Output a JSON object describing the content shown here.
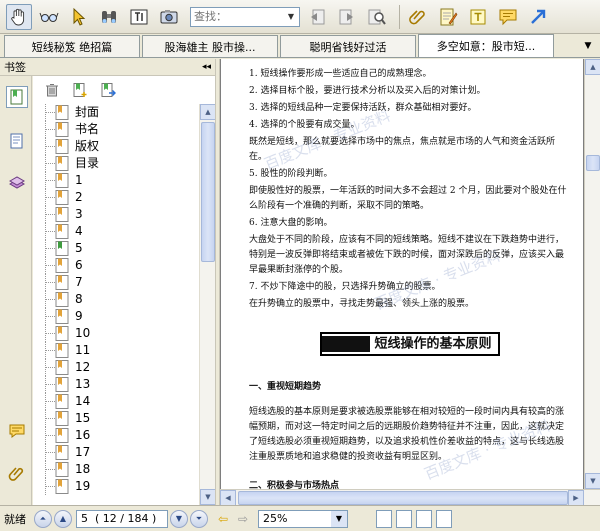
{
  "toolbar": {
    "find_placeholder": "查找："
  },
  "tabs": [
    {
      "label": "短线秘笈 绝招篇"
    },
    {
      "label": "股海雄主 股市操..."
    },
    {
      "label": "聪明省钱好过活"
    },
    {
      "label": "多空如意：股市短..."
    }
  ],
  "bookmarks": {
    "header": "书签",
    "collapse_glyph": "◂◂",
    "items": [
      {
        "label": "封面"
      },
      {
        "label": "书名"
      },
      {
        "label": "版权"
      },
      {
        "label": "目录"
      },
      {
        "label": "1"
      },
      {
        "label": "2"
      },
      {
        "label": "3"
      },
      {
        "label": "4"
      },
      {
        "label": "5"
      },
      {
        "label": "6"
      },
      {
        "label": "7"
      },
      {
        "label": "8"
      },
      {
        "label": "9"
      },
      {
        "label": "10"
      },
      {
        "label": "11"
      },
      {
        "label": "12"
      },
      {
        "label": "13"
      },
      {
        "label": "14"
      },
      {
        "label": "15"
      },
      {
        "label": "16"
      },
      {
        "label": "17"
      },
      {
        "label": "18"
      },
      {
        "label": "19"
      }
    ]
  },
  "document": {
    "lines": [
      "1. 短线操作要形成一些适应自己的成熟理念。",
      "2. 选择目标个股，要进行技术分析以及买入后的对策计划。",
      "3. 选择的短线品种一定要保持活跃，群众基础相对要好。",
      "4. 选择的个股要有成交量。",
      "既然是短线，那么就要选择市场中的焦点，焦点就是市场的人气和资金活跃所在。",
      "5. 股性的阶段判断。",
      "即使股性好的股票，一年活跃的时间大多不会超过 2 个月，因此要对个股处在什么阶段有一个准确的判断，采取不同的策略。",
      "6. 注意大盘的影响。",
      "大盘处于不同的阶段，应该有不同的短线策略。短线不建议在下跌趋势中进行，特别是一波反弹即将结束或者被佐下跌的时候，面对深跌后的反弹，应该买入最早最果断封涨停的个股。",
      "7. 不炒下降途中的股，只选择升势确立的股票。",
      "在升势确立的股票中，寻找走势最强、领头上涨的股票。"
    ],
    "chapter_title": "短线操作的基本原则",
    "section1": "一、重视短期趋势",
    "section1_body": "短线选股的基本原则是要求被选股票能够在相对较短的一段时间内具有较高的涨幅预期，而对这一特定时间之后的远期股价趋势特征并不注重，因此，这就决定了短线选股必须重视短期趋势，以及追求投机性价差收益的特点，这与长线选股注重股票质地和追求稳健的投资收益有明显区别。",
    "section2": "二、积极参与市场热点",
    "watermark": "百度文库 · 专业资料"
  },
  "status": {
    "ready": "就绪",
    "page_value": "5  ( 12 / 184 )",
    "zoom_value": "25%"
  }
}
